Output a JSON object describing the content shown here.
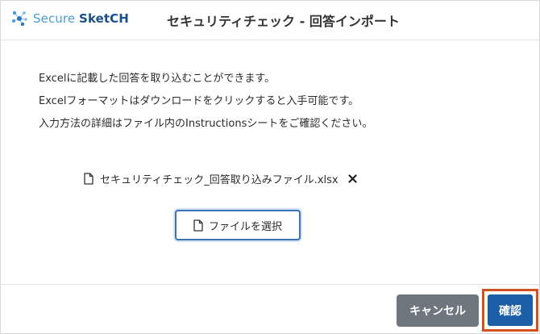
{
  "header": {
    "logo_secure": "Secure",
    "logo_sketch": "SketCH",
    "title": "セキュリティチェック - 回答インポート"
  },
  "description": {
    "lines": [
      "Excelに記載した回答を取り込むことができます。",
      "Excelフォーマットはダウンロードをクリックすると入手可能です。",
      "入力方法の詳細はファイル内のInstructionsシートをご確認ください。"
    ]
  },
  "file": {
    "name": "セキュリティチェック_回答取り込みファイル.xlsx",
    "icon": "file-icon",
    "remove_icon": "close-icon"
  },
  "select_button": {
    "label": "ファイルを選択",
    "icon": "file-icon"
  },
  "footer": {
    "cancel_label": "キャンセル",
    "confirm_label": "確認"
  },
  "colors": {
    "accent": "#1d5ea8",
    "cancel": "#6f767d",
    "highlight": "#d2521f"
  }
}
